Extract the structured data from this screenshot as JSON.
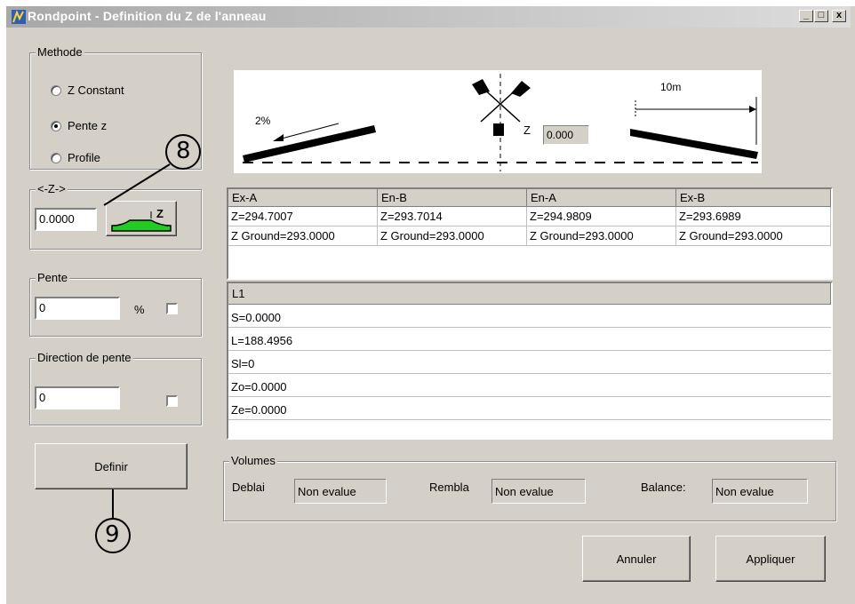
{
  "window": {
    "title": "Rondpoint -  Definition du Z de l'anneau",
    "controls": {
      "minimize": "_",
      "maximize": "□",
      "close": "x"
    }
  },
  "methode": {
    "label": "Methode",
    "options": [
      {
        "label": "Z Constant",
        "checked": false
      },
      {
        "label": "Pente z",
        "checked": true
      },
      {
        "label": "Profile",
        "checked": false
      }
    ]
  },
  "z_group": {
    "label": "<-Z->",
    "value": "0.0000",
    "button_icon": "terrain-z-icon",
    "button_text": "Z"
  },
  "pente": {
    "label": "Pente",
    "value": "0",
    "unit": "%",
    "checked": false
  },
  "direction": {
    "label": "Direction de pente",
    "value": "0",
    "checked": false
  },
  "definir_label": "Definir",
  "callouts": {
    "eight": "8",
    "nine": "9"
  },
  "diagram": {
    "percent": "2%",
    "distance": "10m",
    "z_label": "Z",
    "z_value": "0.000"
  },
  "summary_table": {
    "headers": [
      "Ex-A",
      "En-B",
      "En-A",
      "Ex-B"
    ],
    "rows": [
      [
        "Z=294.7007",
        "Z=293.7014",
        "Z=294.9809",
        "Z=293.6989"
      ],
      [
        "Z Ground=293.0000",
        "Z Ground=293.0000",
        "Z Ground=293.0000",
        "Z Ground=293.0000"
      ]
    ]
  },
  "detail_list": {
    "header": "L1",
    "rows": [
      "S=0.0000",
      "L=188.4956",
      "Sl=0",
      "Zo=0.0000",
      "Ze=0.0000"
    ]
  },
  "volumes": {
    "label": "Volumes",
    "deblai_label": "Deblai",
    "deblai_value": "Non evalue",
    "rembla_label": "Rembla",
    "rembla_value": "Non evalue",
    "balance_label": "Balance:",
    "balance_value": "Non evalue"
  },
  "buttons": {
    "annuler": "Annuler",
    "appliquer": "Appliquer"
  },
  "colors": {
    "face": "#d4d0c8",
    "terrain_green": "#22cc22"
  }
}
